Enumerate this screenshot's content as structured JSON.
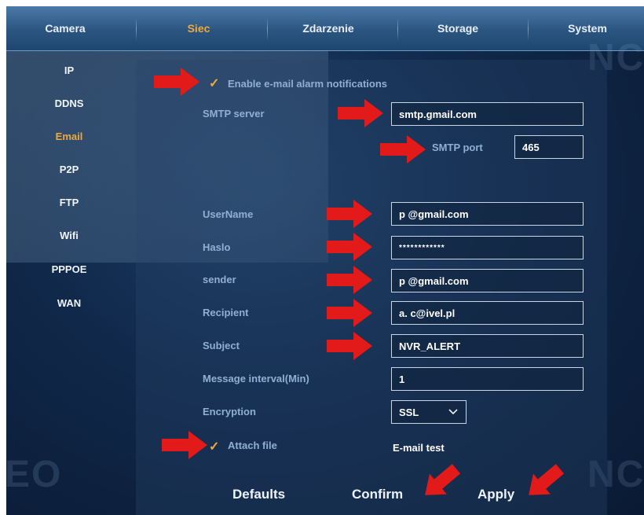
{
  "tabs": [
    {
      "label": "Camera",
      "active": false
    },
    {
      "label": "Siec",
      "active": true
    },
    {
      "label": "Zdarzenie",
      "active": false
    },
    {
      "label": "Storage",
      "active": false
    },
    {
      "label": "System",
      "active": false
    }
  ],
  "watermarks": {
    "top_right": "NC",
    "bottom_left": "EO",
    "bottom_right": "NC"
  },
  "sidebar": {
    "items": [
      {
        "label": "IP",
        "active": false
      },
      {
        "label": "DDNS",
        "active": false
      },
      {
        "label": "Email",
        "active": true
      },
      {
        "label": "P2P",
        "active": false
      },
      {
        "label": "FTP",
        "active": false
      },
      {
        "label": "Wifi",
        "active": false
      },
      {
        "label": "PPPOE",
        "active": false
      },
      {
        "label": "WAN",
        "active": false
      }
    ]
  },
  "form": {
    "enable_label": "Enable e-mail alarm notifications",
    "enable_checked": true,
    "smtp_server_label": "SMTP server",
    "smtp_server_value": "smtp.gmail.com",
    "smtp_port_label": "SMTP port",
    "smtp_port_value": "465",
    "username_label": "UserName",
    "username_value": "p        @gmail.com",
    "password_label": "Haslo",
    "password_value": "************",
    "sender_label": "sender",
    "sender_value": "p        @gmail.com",
    "recipient_label": "Recipient",
    "recipient_value": "a.       c@ivel.pl",
    "subject_label": "Subject",
    "subject_value": "NVR_ALERT",
    "interval_label": "Message interval(Min)",
    "interval_value": "1",
    "encryption_label": "Encryption",
    "encryption_value": "SSL",
    "attach_label": "Attach file",
    "attach_checked": true,
    "email_test_label": "E-mail test"
  },
  "buttons": {
    "defaults": "Defaults",
    "confirm": "Confirm",
    "apply": "Apply"
  },
  "colors": {
    "accent": "#f0a93a",
    "label": "#8fb0d2",
    "arrow": "#e21a1a",
    "background": "#10284a"
  }
}
